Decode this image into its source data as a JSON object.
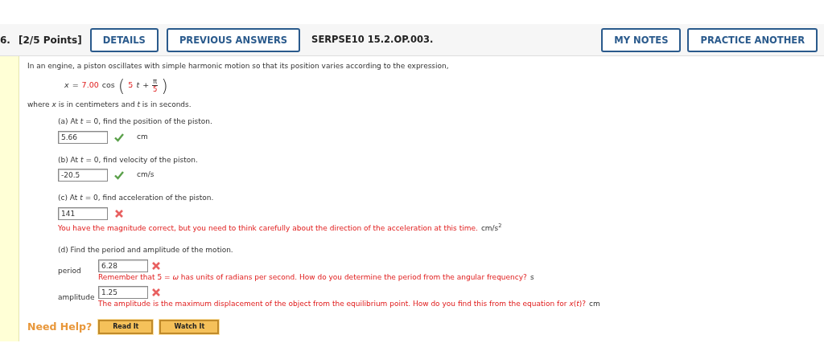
{
  "header": {
    "number": "6.",
    "points": "[2/5 Points]",
    "buttons": [
      {
        "label": "DETAILS"
      },
      {
        "label": "PREVIOUS ANSWERS"
      }
    ],
    "code": "SERPSE10 15.2.OP.003.",
    "right_buttons": [
      {
        "label": "MY NOTES"
      },
      {
        "label": "PRACTICE ANOTHER"
      }
    ]
  },
  "intro": "In an engine, a piston oscillates with simple harmonic motion so that its position varies according to the expression,",
  "equation": {
    "lhs": "x",
    "eq": "=",
    "amplitude": "7.00",
    "func": "cos",
    "open_paren": "(",
    "close_paren": ")",
    "omega": "5",
    "var": "t",
    "plus": "+",
    "numerator": "π",
    "denominator": "5"
  },
  "where": "where *x* is in centimeters and *t* is in seconds.",
  "parts": [
    {
      "question": "(a) At *t* = 0, find the position of the piston.",
      "value": "5.66",
      "correct": true,
      "unit": "cm"
    },
    {
      "question": "(b) At *t* = 0, find velocity of the piston.",
      "value": "-20.5",
      "correct": true,
      "unit": "cm/s"
    },
    {
      "question": "(c) At *t* = 0, find acceleration of the piston.",
      "value": "141",
      "correct": false,
      "feedback": "You have the magnitude correct, but you need to think carefully about the direction of the acceleration at this time.",
      "unit": "cm/s$^{2}$"
    }
  ],
  "part_d": {
    "question": "(d) Find the period and amplitude of the motion.",
    "rows": [
      {
        "label": "period",
        "value": "6.28",
        "correct": false,
        "feedback": "Remember that 5 = *ω* has units of radians per second. How do you determine the period from the angular frequency?",
        "unit": "s"
      },
      {
        "label": "amplitude",
        "value": "1.25",
        "correct": false,
        "feedback": "The amplitude is the maximum displacement of the object from the equilibrium point. How do you find this from the equation for *x*(*t*)?",
        "unit": "cm"
      }
    ]
  },
  "help": {
    "label": "Need Help?",
    "buttons": [
      {
        "label": "Read It"
      },
      {
        "label": "Watch It"
      }
    ]
  }
}
